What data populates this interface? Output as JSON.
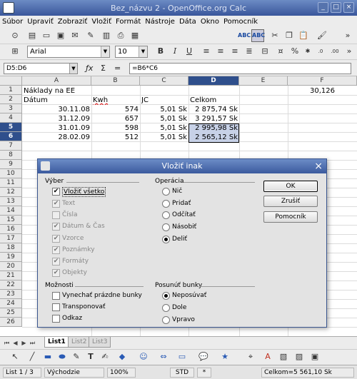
{
  "window": {
    "title": "Bez_názvu 2 - OpenOffice.org Calc"
  },
  "menu": [
    "Súbor",
    "Upraviť",
    "Zobraziť",
    "Vložiť",
    "Formát",
    "Nástroje",
    "Dáta",
    "Okno",
    "Pomocník"
  ],
  "format_toolbar": {
    "font_name": "Arial",
    "font_size": "10"
  },
  "formula_bar": {
    "name_box": "D5:D6",
    "formula": "=B6*C6"
  },
  "columns": [
    "A",
    "B",
    "C",
    "D",
    "E",
    "F"
  ],
  "rows": [
    "1",
    "2",
    "3",
    "4",
    "5",
    "6",
    "7",
    "8",
    "9",
    "10",
    "11",
    "12",
    "13",
    "14",
    "15",
    "16",
    "17",
    "18",
    "19",
    "20",
    "21",
    "22",
    "23",
    "24",
    "25",
    "26"
  ],
  "cells": {
    "A1": "Náklady na EE",
    "F1": "30,126",
    "A2": "Dátum",
    "B2": "Kwh",
    "C2": "JC",
    "D2": "Celkom",
    "A3": "30.11.08",
    "B3": "574",
    "C3": "5,01 Sk",
    "D3": "2 875,74 Sk",
    "A4": "31.12.09",
    "B4": "657",
    "C4": "5,01 Sk",
    "D4": "3 291,57 Sk",
    "A5": "31.01.09",
    "B5": "598",
    "C5": "5,01 Sk",
    "D5": "2 995,98 Sk",
    "A6": "28.02.09",
    "B6": "512",
    "C6": "5,01 Sk",
    "D6": "2 565,12 Sk"
  },
  "dialog": {
    "title": "Vložiť inak",
    "selection_label": "Výber",
    "selection": [
      {
        "label": "Vložiť všetko",
        "checked": true,
        "disabled": false
      },
      {
        "label": "Text",
        "checked": true,
        "disabled": true
      },
      {
        "label": "Čísla",
        "checked": false,
        "disabled": true
      },
      {
        "label": "Dátum & Čas",
        "checked": true,
        "disabled": true
      },
      {
        "label": "Vzorce",
        "checked": true,
        "disabled": true
      },
      {
        "label": "Poznámky",
        "checked": true,
        "disabled": true
      },
      {
        "label": "Formáty",
        "checked": true,
        "disabled": true
      },
      {
        "label": "Objekty",
        "checked": true,
        "disabled": true
      }
    ],
    "operation_label": "Operácia",
    "operations": [
      {
        "label": "Nič",
        "selected": false
      },
      {
        "label": "Pridať",
        "selected": false
      },
      {
        "label": "Odčítať",
        "selected": false
      },
      {
        "label": "Násobiť",
        "selected": false
      },
      {
        "label": "Deliť",
        "selected": true
      }
    ],
    "options_label": "Možnosti",
    "options": [
      {
        "label": "Vynechať prázdne bunky",
        "checked": false
      },
      {
        "label": "Transponovať",
        "checked": false
      },
      {
        "label": "Odkaz",
        "checked": false
      }
    ],
    "shift_label": "Posunúť bunky",
    "shift": [
      {
        "label": "Neposúvať",
        "selected": true
      },
      {
        "label": "Dole",
        "selected": false
      },
      {
        "label": "Vpravo",
        "selected": false
      }
    ],
    "buttons": {
      "ok": "OK",
      "cancel": "Zrušiť",
      "help": "Pomocník"
    }
  },
  "sheet_tabs": [
    "List1",
    "List2",
    "List3"
  ],
  "status_bar": {
    "sheet": "List 1 / 3",
    "style": "Východzie",
    "zoom": "100%",
    "mode": "STD",
    "modified": "*",
    "sum": "Celkom=5 561,10 Sk"
  },
  "colors": {
    "titlebar": "#3b5a9e",
    "selection": "#c7d1e7",
    "header_highlight": "#2f4f8c"
  }
}
